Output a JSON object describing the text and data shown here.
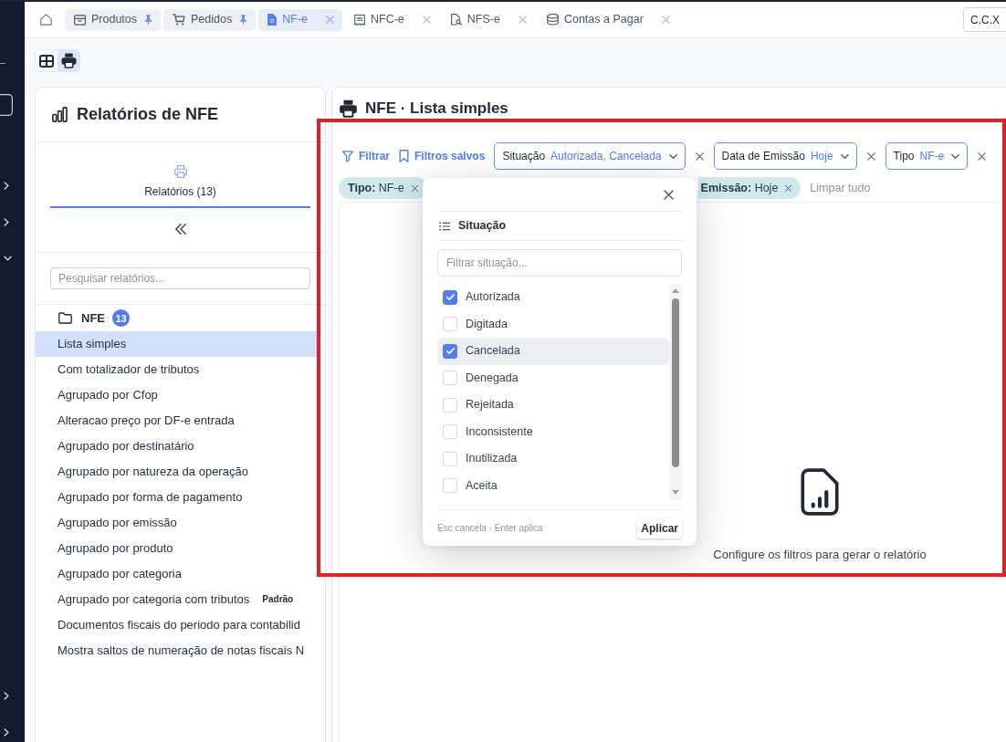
{
  "nav_rail": {
    "top_groups": [
      {
        "expanded": false
      },
      {
        "expanded": false
      },
      {
        "expanded": true
      }
    ],
    "bottom_groups": [
      {
        "expanded": false
      },
      {
        "expanded": false
      }
    ]
  },
  "tabs": [
    {
      "label": "Produtos",
      "pinned": true,
      "selected": false
    },
    {
      "label": "Pedidos",
      "pinned": true,
      "selected": false
    },
    {
      "label": "NF-e",
      "pinned": false,
      "selected": true
    },
    {
      "label": "NFC-e",
      "pinned": false,
      "selected": false
    },
    {
      "label": "NFS-e",
      "pinned": false,
      "selected": false
    },
    {
      "label": "Contas a Pagar",
      "pinned": false,
      "selected": false
    }
  ],
  "account_button": {
    "label": "C.C.X"
  },
  "view_toggle": [
    {
      "selected": false
    },
    {
      "selected": true
    }
  ],
  "reports_panel": {
    "title": "Relatórios de NFE",
    "tab": {
      "label": "Relatórios (13)",
      "selected": true
    },
    "search": {
      "placeholder": "Pesquisar relatórios..."
    },
    "folder": {
      "label": "NFE",
      "count": "13"
    },
    "items": [
      {
        "label": "Lista simples",
        "selected": true
      },
      {
        "label": "Com totalizador de tributos",
        "selected": false
      },
      {
        "label": "Agrupado por Cfop",
        "selected": false
      },
      {
        "label": "Alteracao preço por DF-e entrada",
        "selected": false
      },
      {
        "label": "Agrupado por destinatário",
        "selected": false
      },
      {
        "label": "Agrupado por natureza da operação",
        "selected": false
      },
      {
        "label": "Agrupado por forma de pagamento",
        "selected": false
      },
      {
        "label": "Agrupado por emissão",
        "selected": false
      },
      {
        "label": "Agrupado por produto",
        "selected": false
      },
      {
        "label": "Agrupado por categoria",
        "selected": false
      },
      {
        "label": "Agrupado por categoria com tributos",
        "selected": false,
        "badge": "Padrão"
      },
      {
        "label": "Documentos fiscais do periodo para contabilid",
        "selected": false
      },
      {
        "label": "Mostra saltos de numeração de notas fiscais N",
        "selected": false
      }
    ]
  },
  "report_view": {
    "title": "NFE · Lista simples",
    "filter_button": "Filtrar",
    "saved_filters_button": "Filtros salvos",
    "filters": [
      {
        "label": "Situação",
        "value": "Autorizada, Cancelada"
      },
      {
        "label": "Data de Emissão",
        "value": "Hoje"
      },
      {
        "label": "Tipo",
        "value": "NF-e"
      }
    ],
    "chips": [
      {
        "kind": "full",
        "text": "**Tipo:** NF-e"
      },
      {
        "kind": "covered",
        "text": "**Emissão:** Hoje"
      }
    ],
    "clear_all": "Limpar tudo",
    "empty_state": {
      "message": "Configure os filtros para gerar o relatório"
    }
  },
  "situation_popup": {
    "title": "Situação",
    "search": {
      "placeholder": "Filtrar situação..."
    },
    "options": [
      {
        "label": "Autorizada",
        "checked": true,
        "highlighted": false
      },
      {
        "label": "Digitada",
        "checked": false,
        "highlighted": false
      },
      {
        "label": "Cancelada",
        "checked": true,
        "highlighted": true
      },
      {
        "label": "Denegada",
        "checked": false,
        "highlighted": false
      },
      {
        "label": "Rejeitada",
        "checked": false,
        "highlighted": false
      },
      {
        "label": "Inconsistente",
        "checked": false,
        "highlighted": false
      },
      {
        "label": "Inutilizada",
        "checked": false,
        "highlighted": false
      },
      {
        "label": "Aceita",
        "checked": false,
        "highlighted": false
      }
    ],
    "hint": "Esc cancela · Enter aplica",
    "apply_button": "Aplicar"
  }
}
